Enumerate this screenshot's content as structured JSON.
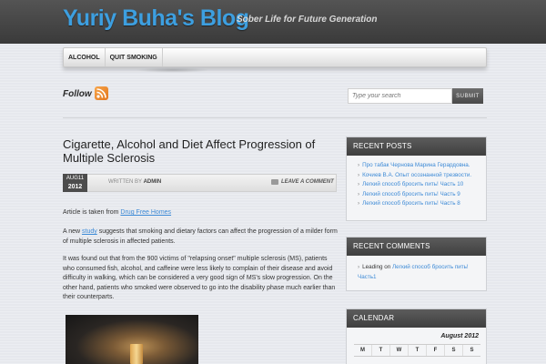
{
  "header": {
    "blog_title": "Yuriy Buha's Blog",
    "tagline": "Sober Life for Future Generation"
  },
  "nav": {
    "items": [
      {
        "label": "ALCOHOL"
      },
      {
        "label": "QUIT SMOKING"
      }
    ]
  },
  "follow": {
    "label": "Follow",
    "icon": "rss-icon"
  },
  "search": {
    "placeholder": "Type your search",
    "button_label": "SUBMIT"
  },
  "post": {
    "title": "Cigarette, Alcohol and Diet Affect Progression of Multiple Sclerosis",
    "date_month_day": "AUG11",
    "date_year": "2012",
    "written_by": "WRITTEN BY",
    "author": "ADMIN",
    "comment_link": "LEAVE A COMMENT",
    "para1_prefix": "Article is taken from ",
    "para1_link": "Drug Free Homes",
    "para2_prefix": "A new ",
    "para2_link": "study",
    "para2_rest": " suggests that smoking and dietary factors can affect the progression of a milder form of multiple sclerosis in affected patients.",
    "para3": "It was found out that from the 900 victims of \"relapsing onset\" multiple sclerosis (MS), patients who consumed fish, alcohol, and caffeine were less likely to complain of their disease and avoid difficulty in walking, which can be considered a very good sign of MS's slow progression. On the other hand, patients who smoked were observed to go into the disability phase much earlier than their counterparts."
  },
  "sidebar": {
    "recent_posts": {
      "title": "RECENT POSTS",
      "items": [
        "Про табак Чернова Марина Герардовна.",
        "Кочиев В.А. Опыт осознанной трезвости.",
        "Легкий способ бросить пить! Часть 10",
        "Легкий способ бросить пить! Часть 9",
        "Легкий способ бросить пить! Часть 8"
      ]
    },
    "recent_comments": {
      "title": "RECENT COMMENTS",
      "author": "Leading",
      "on": "on",
      "link": "Легкий способ бросить пить! Часть1"
    },
    "calendar": {
      "title": "CALENDAR",
      "month": "August 2012",
      "days": [
        "M",
        "T",
        "W",
        "T",
        "F",
        "S",
        "S"
      ]
    }
  },
  "colors": {
    "accent": "#3d9fe0",
    "link": "#3d8ad6",
    "header_bg": "#474747",
    "widget_header": "#4a4a4a"
  }
}
